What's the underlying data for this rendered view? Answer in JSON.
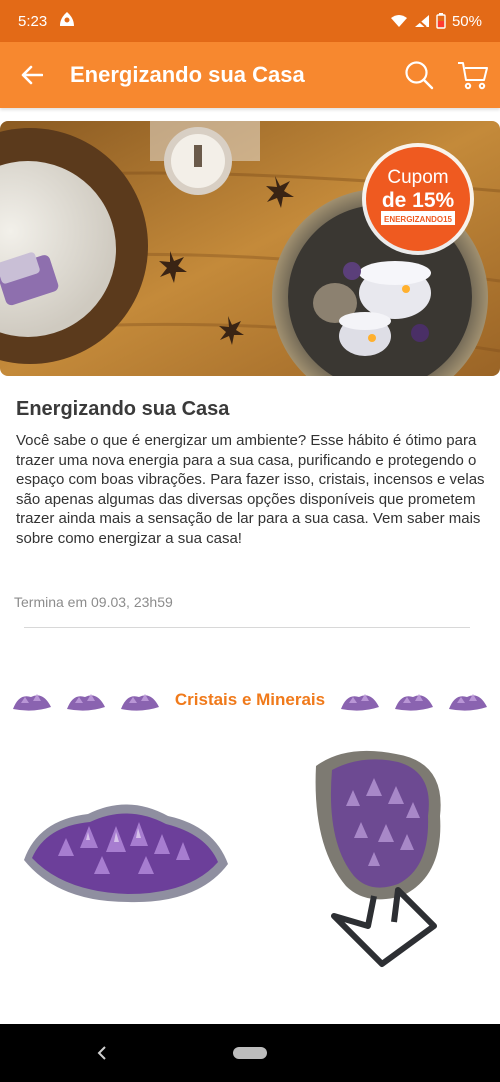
{
  "status": {
    "time": "5:23",
    "battery": "50%"
  },
  "appbar": {
    "title": "Energizando sua Casa"
  },
  "banner": {
    "coupon_line1": "Cupom",
    "coupon_line2": "de 15%",
    "coupon_code": "ENERGIZANDO15"
  },
  "content": {
    "headline": "Energizando sua Casa",
    "description": "Você sabe o que é energizar um ambiente? Esse hábito é ótimo para trazer uma nova energia para a sua casa, purificando e protegendo o espaço com boas vibrações. Para fazer isso, cristais, incensos e velas são apenas algumas das diversas opções disponíveis que prometem trazer ainda mais a sensação de lar para a sua casa. Vem saber mais sobre como energizar a sua casa!",
    "ends": "Termina em 09.03, 23h59"
  },
  "section": {
    "label": "Cristais e Minerais"
  },
  "colors": {
    "primary": "#f7882f",
    "status": "#e36a17",
    "accent_text": "#f07a1b",
    "coupon": "#ef5a20"
  }
}
